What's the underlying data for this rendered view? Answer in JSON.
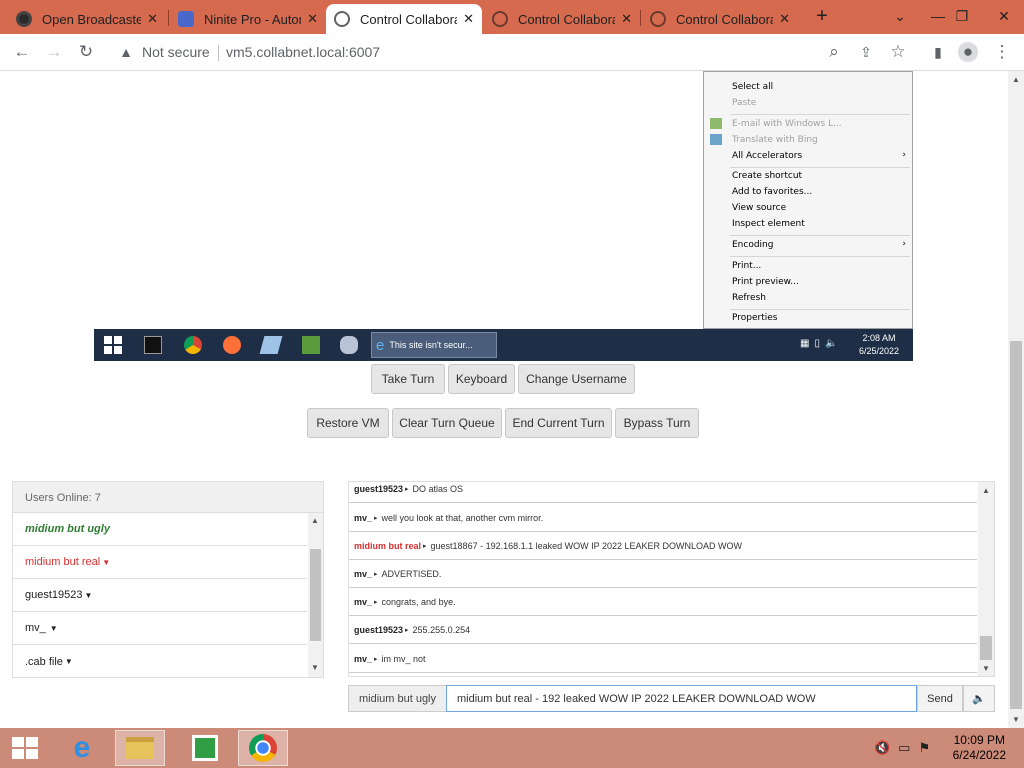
{
  "browser": {
    "tabs": [
      {
        "title": "Open Broadcaster",
        "icon": "obs-icon",
        "active": false
      },
      {
        "title": "Ninite Pro - Autom",
        "icon": "ninite-icon",
        "active": false
      },
      {
        "title": "Control Collabora",
        "icon": "globe-icon",
        "active": true
      },
      {
        "title": "Control Collabora",
        "icon": "globe-icon",
        "active": false
      },
      {
        "title": "Control Collabora",
        "icon": "globe-icon",
        "active": false
      }
    ],
    "security_label": "Not secure",
    "url": "vm5.collabnet.local:6007",
    "tab_strip_color": "#d66a4f"
  },
  "vm": {
    "context_menu": [
      {
        "label": "Select all",
        "disabled": false
      },
      {
        "label": "Paste",
        "disabled": true
      },
      {
        "label": "E-mail with Windows L...",
        "disabled": true
      },
      {
        "label": "Translate with Bing",
        "disabled": true
      },
      {
        "label": "All Accelerators",
        "disabled": false,
        "submenu": true
      },
      {
        "label": "Create shortcut",
        "disabled": false
      },
      {
        "label": "Add to favorites...",
        "disabled": false
      },
      {
        "label": "View source",
        "disabled": false
      },
      {
        "label": "Inspect element",
        "disabled": false
      },
      {
        "label": "Encoding",
        "disabled": false,
        "submenu": true
      },
      {
        "label": "Print...",
        "disabled": false
      },
      {
        "label": "Print preview...",
        "disabled": false
      },
      {
        "label": "Refresh",
        "disabled": false
      },
      {
        "label": "Properties",
        "disabled": false
      }
    ],
    "taskbar": {
      "task_label": "This site isn't secur...",
      "time": "2:08 AM",
      "date": "6/25/2022"
    }
  },
  "controls": {
    "row1": [
      "Take Turn",
      "Keyboard",
      "Change Username"
    ],
    "row2": [
      "Restore VM",
      "Clear Turn Queue",
      "End Current Turn",
      "Bypass Turn"
    ]
  },
  "users": {
    "header": "Users Online: 7",
    "list": [
      {
        "name": "midium but ugly",
        "style": "self",
        "color": "#2e7d32",
        "dropdown": false
      },
      {
        "name": "midium but real",
        "style": "turn",
        "color": "#d32f2f",
        "dropdown": true
      },
      {
        "name": "guest19523",
        "style": "normal",
        "color": "#222222",
        "dropdown": true
      },
      {
        "name": "mv_",
        "style": "normal",
        "color": "#222222",
        "dropdown": true
      },
      {
        "name": ".cab file",
        "style": "normal",
        "color": "#222222",
        "dropdown": true
      }
    ]
  },
  "chat": {
    "messages": [
      {
        "user": "guest19523",
        "user_color": "#222222",
        "text": "DO atlas OS"
      },
      {
        "user": "mv_",
        "user_color": "#222222",
        "text": "well you look at that, another cvm mirror."
      },
      {
        "user": "midium but real",
        "user_color": "#d32f2f",
        "text": "guest18867 - 192.168.1.1 leaked WOW IP 2022 LEAKER DOWNLOAD WOW"
      },
      {
        "user": "mv_",
        "user_color": "#222222",
        "text": "ADVERTISED."
      },
      {
        "user": "mv_",
        "user_color": "#222222",
        "text": "congrats, and bye."
      },
      {
        "user": "guest19523",
        "user_color": "#222222",
        "text": "255.255.0.254"
      },
      {
        "user": "mv_",
        "user_color": "#222222",
        "text": "im mv_ not"
      }
    ],
    "username": "midium but ugly",
    "input_value": "midium but real - 192 leaked WOW IP 2022 LEAKER DOWNLOAD WOW",
    "send_label": "Send"
  },
  "host": {
    "time": "10:09 PM",
    "date": "6/24/2022"
  }
}
